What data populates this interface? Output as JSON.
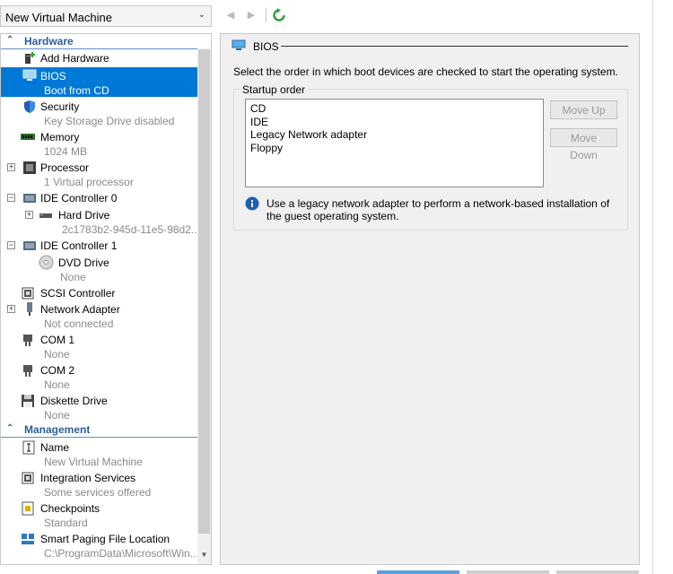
{
  "header": {
    "vm_name": "New Virtual Machine"
  },
  "sidebar": {
    "hardware_heading": "Hardware",
    "management_heading": "Management",
    "hardware_items": [
      {
        "name": "Add Hardware",
        "sub": "",
        "icon": "add-hardware-icon"
      },
      {
        "name": "BIOS",
        "sub": "Boot from CD",
        "icon": "bios-icon"
      },
      {
        "name": "Security",
        "sub": "Key Storage Drive disabled",
        "icon": "shield-icon"
      },
      {
        "name": "Memory",
        "sub": "1024 MB",
        "icon": "memory-icon"
      },
      {
        "name": "Processor",
        "sub": "1 Virtual processor",
        "icon": "processor-icon"
      },
      {
        "name": "IDE Controller 0",
        "sub": "",
        "icon": "controller-icon"
      },
      {
        "name": "Hard Drive",
        "sub": "2c1783b2-945d-11e5-98d2...",
        "icon": "hard-drive-icon"
      },
      {
        "name": "IDE Controller 1",
        "sub": "",
        "icon": "controller-icon"
      },
      {
        "name": "DVD Drive",
        "sub": "None",
        "icon": "dvd-icon"
      },
      {
        "name": "SCSI Controller",
        "sub": "",
        "icon": "scsi-icon"
      },
      {
        "name": "Network Adapter",
        "sub": "Not connected",
        "icon": "network-icon"
      },
      {
        "name": "COM 1",
        "sub": "None",
        "icon": "com-port-icon"
      },
      {
        "name": "COM 2",
        "sub": "None",
        "icon": "com-port-icon"
      },
      {
        "name": "Diskette Drive",
        "sub": "None",
        "icon": "diskette-icon"
      }
    ],
    "management_items": [
      {
        "name": "Name",
        "sub": "New Virtual Machine",
        "icon": "name-icon"
      },
      {
        "name": "Integration Services",
        "sub": "Some services offered",
        "icon": "integration-icon"
      },
      {
        "name": "Checkpoints",
        "sub": "Standard",
        "icon": "checkpoints-icon"
      },
      {
        "name": "Smart Paging File Location",
        "sub": "C:\\ProgramData\\Microsoft\\Win...",
        "icon": "paging-icon"
      }
    ]
  },
  "bios": {
    "section_title": "BIOS",
    "description": "Select the order in which boot devices are checked to start the operating system.",
    "startup_order_label": "Startup order",
    "boot_devices": [
      "CD",
      "IDE",
      "Legacy Network adapter",
      "Floppy"
    ],
    "move_up_label": "Move Up",
    "move_down_label": "Move Down",
    "info_text": "Use a legacy network adapter to perform a network-based installation of the guest operating system."
  },
  "colors": {
    "selection": "#0078d7",
    "heading": "#2c5f9a",
    "panel_bg": "#f0f0f0"
  }
}
